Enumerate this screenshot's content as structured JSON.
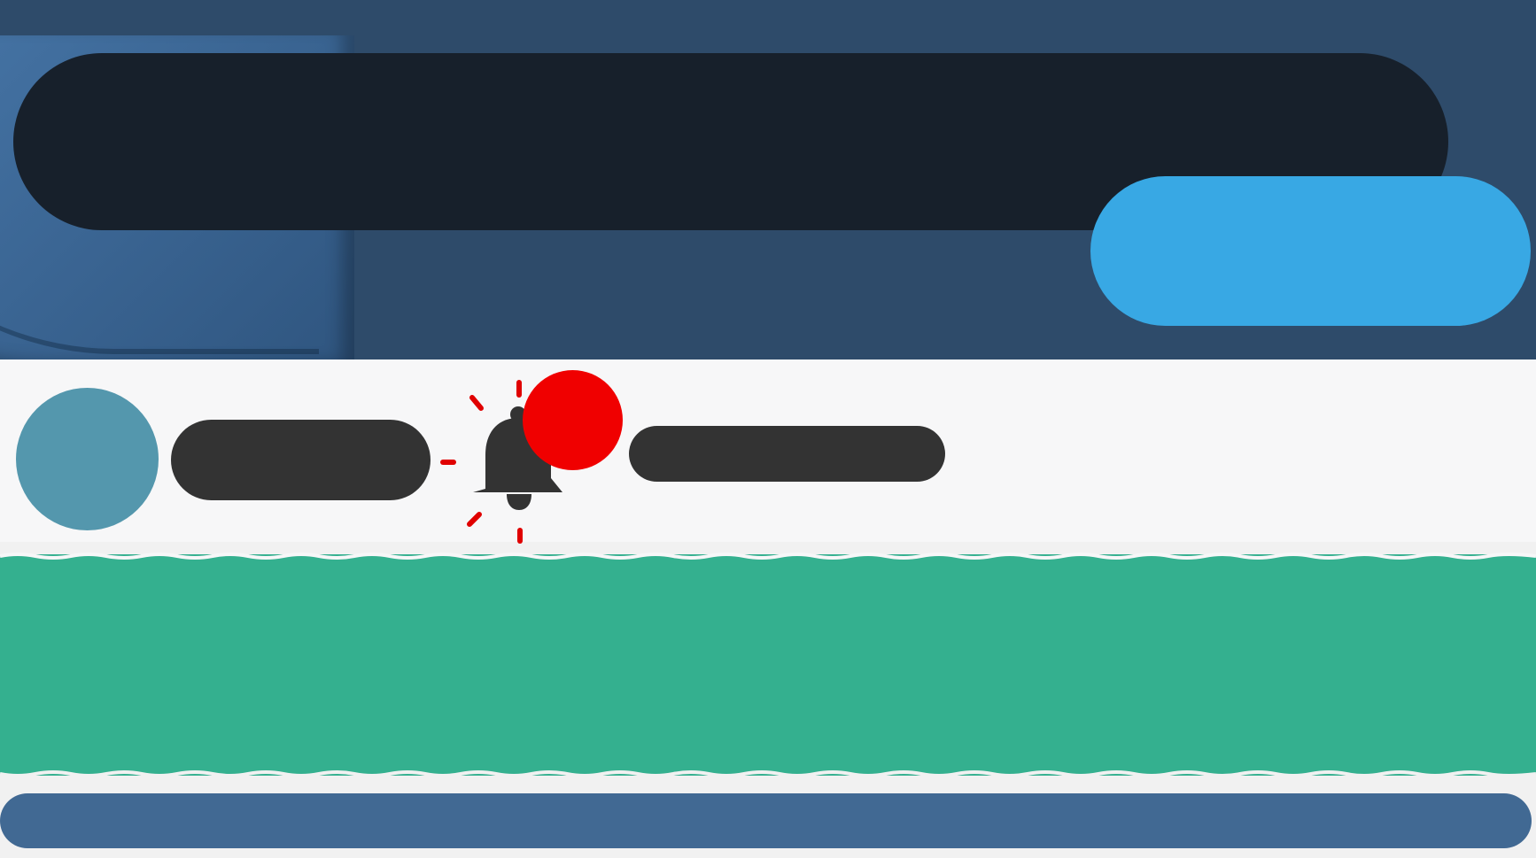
{
  "header": {
    "search": {
      "placeholder": "",
      "value": ""
    },
    "cta_button": {
      "label": ""
    }
  },
  "profile_bar": {
    "user_name": "",
    "notification_count": "",
    "notification_message": ""
  },
  "banner": {
    "text": ""
  },
  "bottom_bar": {
    "text": ""
  },
  "colors": {
    "header_bg": "#2e4b6a",
    "search_bg": "#17202b",
    "cta_bg": "#38a8e4",
    "avatar_bg": "#5497ad",
    "pill_dark": "#333333",
    "badge_red": "#f00000",
    "banner_green": "#34b08f",
    "bottom_bar_bg": "#416993"
  },
  "icons": {
    "notification": "bell-icon"
  }
}
